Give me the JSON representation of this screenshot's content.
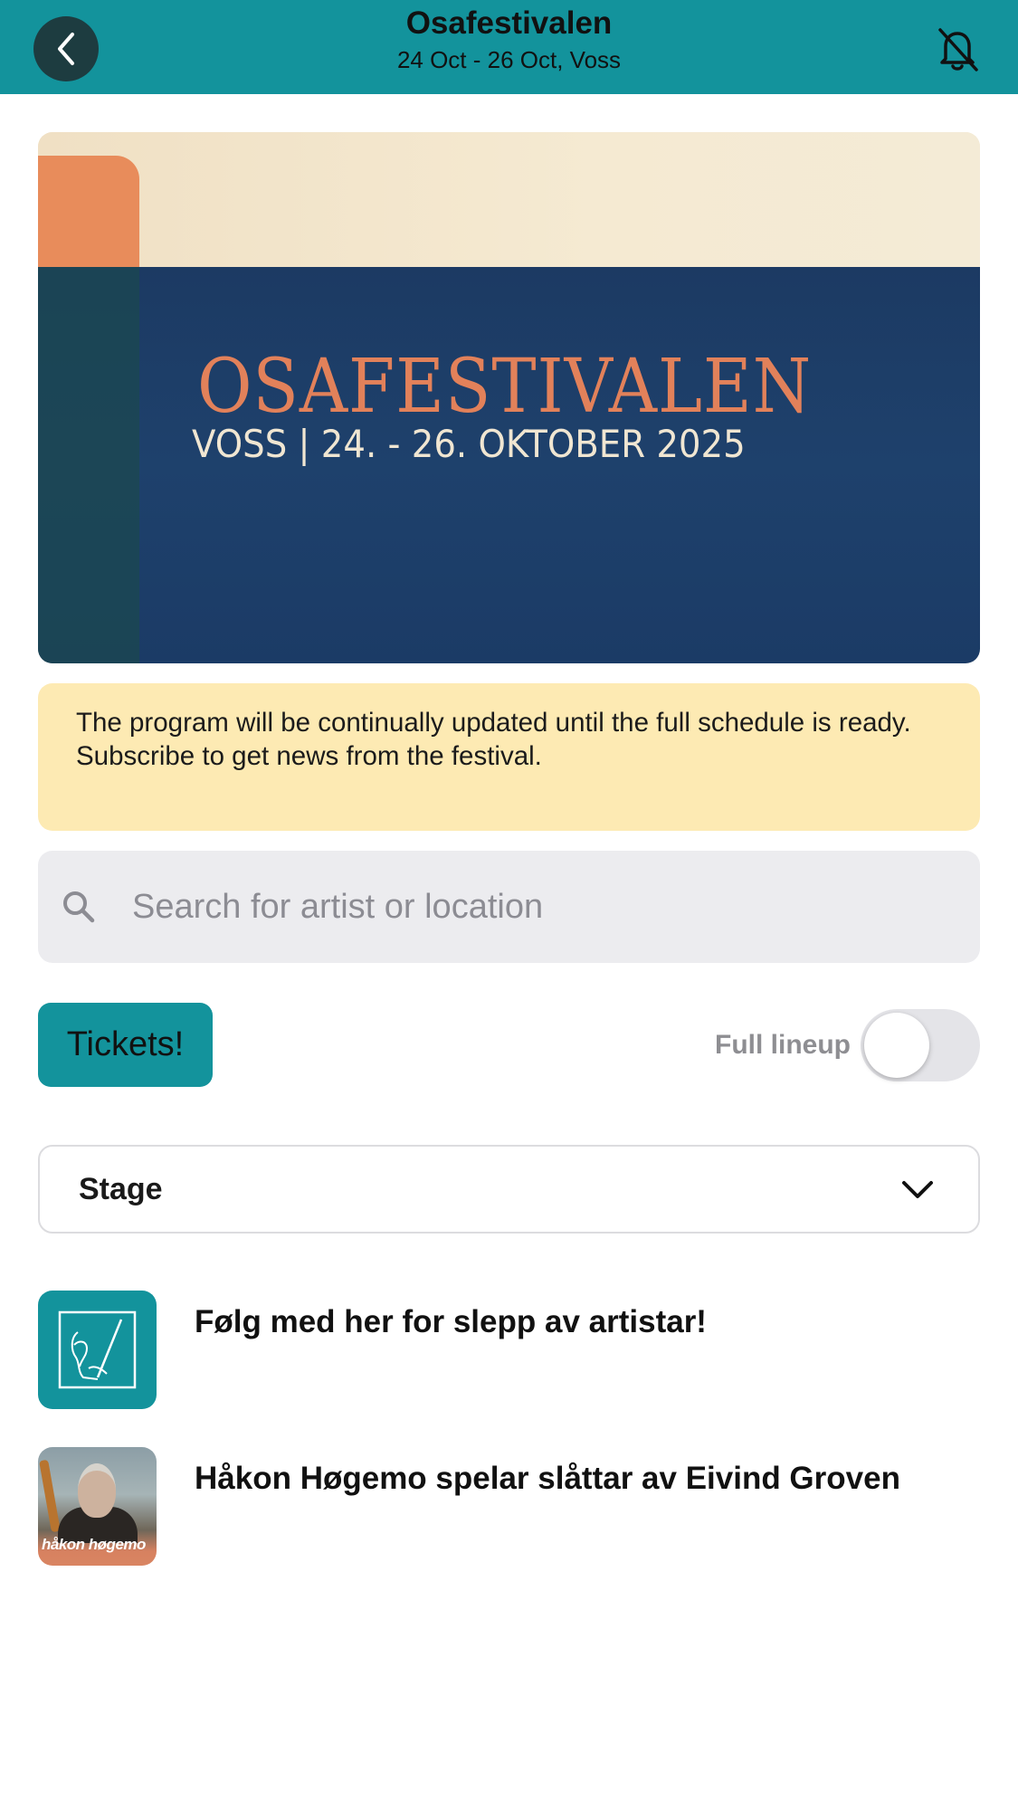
{
  "header": {
    "title": "Osafestivalen",
    "subtitle": "24 Oct - 26 Oct, Voss",
    "back_icon": "chevron-left-icon",
    "notify_icon": "bell-off-icon",
    "background_color": "#13939c"
  },
  "poster": {
    "festival_name": "OSAFESTIVALEN",
    "dates_text": "VOSS  |  24. - 26. OKTOBER 2025"
  },
  "notice": {
    "line1": "The program will be continually updated until the full schedule is ready.",
    "line2": "Subscribe to get news from the festival."
  },
  "search": {
    "placeholder": "Search for artist or location",
    "value": ""
  },
  "controls": {
    "tickets_label": "Tickets!",
    "full_lineup_label": "Full lineup",
    "full_lineup_on": false
  },
  "filter": {
    "stage_label": "Stage"
  },
  "items": [
    {
      "title": "Følg med her for slepp av artistar!",
      "thumb": "festival-logo"
    },
    {
      "title": "Håkon Høgemo spelar slåttar av Eivind Groven",
      "thumb": "artist-photo",
      "thumb_caption": "håkon høgemo"
    }
  ],
  "colors": {
    "accent": "#13939c",
    "notice_bg": "#fdeab3",
    "search_bg": "#ececef"
  }
}
